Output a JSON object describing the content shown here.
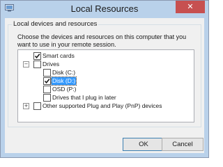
{
  "window": {
    "title": "Local Resources",
    "close_glyph": "✕"
  },
  "group": {
    "legend": "Local devices and resources",
    "description": "Choose the devices and resources on this computer that you want to use in your remote session."
  },
  "tree": {
    "items": [
      {
        "label": "Smart cards",
        "checked": true
      },
      {
        "label": "Drives",
        "checked": false,
        "expanded": true,
        "expander_glyph": "−"
      },
      {
        "label": "Disk (C:)",
        "checked": false
      },
      {
        "label": "Disk (D:)",
        "checked": true,
        "selected": true
      },
      {
        "label": "OSD (P:)",
        "checked": false
      },
      {
        "label": "Drives that I plug in later",
        "checked": false
      },
      {
        "label": "Other supported Plug and Play (PnP) devices",
        "checked": false,
        "expanded": false,
        "expander_glyph": "+"
      }
    ]
  },
  "buttons": {
    "ok": "OK",
    "cancel": "Cancel"
  },
  "colors": {
    "titlebar": "#b9d1ea",
    "close_button": "#c75050",
    "selection": "#3399ff",
    "dialog_bg": "#f0f0f0"
  }
}
